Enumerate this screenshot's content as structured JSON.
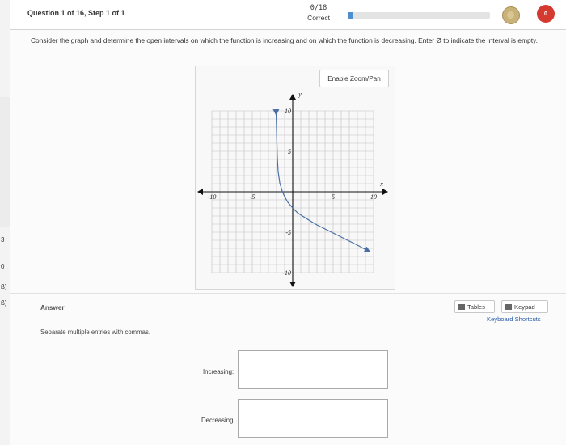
{
  "header": {
    "question_label": "Question 1 of 16, Step 1 of 1",
    "score": "0/18",
    "score_status": "Correct",
    "progress_fraction": 0.04,
    "notification_count": "0"
  },
  "prompt": "Consider the graph and determine the open intervals on which the function is increasing and on which the function is decreasing. Enter Ø to indicate the interval is empty.",
  "graph": {
    "zoom_button": "Enable Zoom/Pan",
    "x_axis_label": "x",
    "y_axis_label": "y",
    "x_ticks": [
      "-10",
      "-5",
      "5",
      "10"
    ],
    "y_ticks": [
      "10",
      "5",
      "-5",
      "-10"
    ]
  },
  "answer": {
    "label": "Answer",
    "helper": "Separate multiple entries with commas.",
    "tables_button": "Tables",
    "keypad_button": "Keypad",
    "keyboard_shortcuts": "Keyboard Shortcuts",
    "increasing_label": "Increasing:",
    "decreasing_label": "Decreasing:",
    "increasing_value": "",
    "decreasing_value": ""
  },
  "sidebar": {
    "marks": [
      "3",
      "0",
      "ß)",
      "ß)"
    ]
  },
  "colors": {
    "curve": "#4b6fa5",
    "axis": "#111111",
    "grid": "#bfbfbf",
    "accent": "#2a5da8",
    "badge": "#d43a2f"
  }
}
